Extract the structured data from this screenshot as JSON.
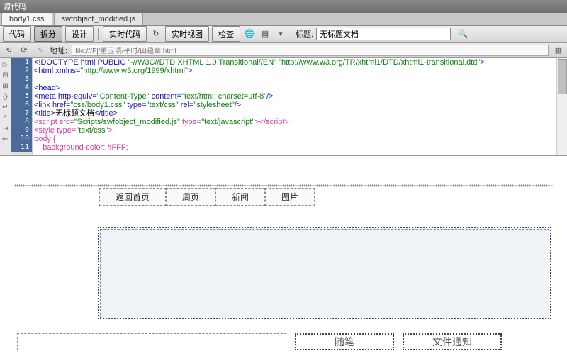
{
  "title_bar": "源代码",
  "file_tabs": [
    "body1.css",
    "swfobject_modified.js"
  ],
  "modes": {
    "code": "代码",
    "split": "拆分",
    "design": "设计",
    "live_code": "实时代码",
    "live_view": "实时视图",
    "inspect": "检查"
  },
  "doc_title_label": "标题:",
  "doc_title_value": "无标题文档",
  "address_label": "地址:",
  "address_value": "file:///F|/董玉项/平时/田蕴章.html",
  "line_numbers": [
    "1",
    "2",
    "3",
    "4",
    "5",
    "6",
    "7",
    "8",
    "9",
    "10",
    "11"
  ],
  "code": {
    "l1_a": "<!DOCTYPE html PUBLIC ",
    "l1_b": "\"-//W3C//DTD XHTML 1.0 Transitional//EN\"",
    "l1_c": " ",
    "l1_d": "\"http://www.w3.org/TR/xhtml1/DTD/xhtml1-transitional.dtd\"",
    "l1_e": ">",
    "l2_a": "<html xmlns=",
    "l2_b": "\"http://www.w3.org/1999/xhtml\"",
    "l2_c": ">",
    "l4": "<head>",
    "l5_a": "<meta http-equiv=",
    "l5_b": "\"Content-Type\"",
    "l5_c": " content=",
    "l5_d": "\"text/html; charset=utf-8\"",
    "l5_e": "/>",
    "l6_a": "<link href=",
    "l6_b": "\"css/body1.css\"",
    "l6_c": " type=",
    "l6_d": "\"text/css\"",
    "l6_e": " rel=",
    "l6_f": "\"stylesheet\"",
    "l6_g": "/>",
    "l7_a": "<title>",
    "l7_b": "无标题文档",
    "l7_c": "</title>",
    "l8_a": "<script src=",
    "l8_b": "\"Scripts/swfobject_modified.js\"",
    "l8_c": " type=",
    "l8_d": "\"text/javascript\"",
    "l8_e": "></script>",
    "l9_a": "<style type=",
    "l9_b": "\"text/css\"",
    "l9_c": ">",
    "l10": "body {",
    "l11": "    background-color: #FFF;"
  },
  "design": {
    "nav": [
      "返回首页",
      "周页",
      "新闻",
      "图片"
    ],
    "box_label_1": "随笔",
    "box_label_2": "文件通知"
  }
}
